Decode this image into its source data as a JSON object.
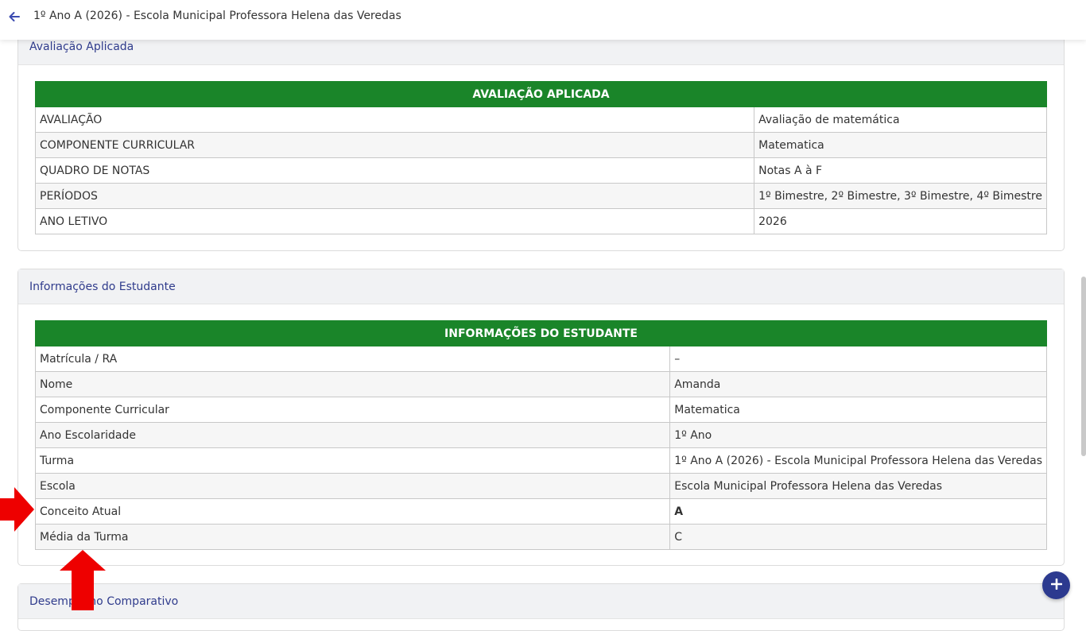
{
  "header": {
    "title": "1º Ano A (2026) - Escola Municipal Professora Helena das Veredas"
  },
  "section1": {
    "title": "Avaliação Aplicada",
    "table_title": "AVALIAÇÃO APLICADA",
    "rows": [
      {
        "label": "AVALIAÇÃO",
        "value": "Avaliação de matemática"
      },
      {
        "label": "COMPONENTE CURRICULAR",
        "value": "Matematica"
      },
      {
        "label": "QUADRO DE NOTAS",
        "value": "Notas A à F"
      },
      {
        "label": "PERÍODOS",
        "value": "1º Bimestre, 2º Bimestre, 3º Bimestre, 4º Bimestre"
      },
      {
        "label": "ANO LETIVO",
        "value": "2026"
      }
    ]
  },
  "section2": {
    "title": "Informações do Estudante",
    "table_title": "INFORMAÇÕES DO ESTUDANTE",
    "rows": [
      {
        "label": "Matrícula / RA",
        "value": "–"
      },
      {
        "label": "Nome",
        "value": "Amanda"
      },
      {
        "label": "Componente Curricular",
        "value": "Matematica"
      },
      {
        "label": "Ano Escolaridade",
        "value": "1º Ano"
      },
      {
        "label": "Turma",
        "value": "1º Ano A (2026) - Escola Municipal Professora Helena das Veredas"
      },
      {
        "label": "Escola",
        "value": "Escola Municipal Professora Helena das Veredas"
      },
      {
        "label": "Conceito Atual",
        "value": "A"
      },
      {
        "label": "Média da Turma",
        "value": "C"
      }
    ]
  },
  "section3": {
    "title": "Desempenho Comparativo"
  },
  "fab": {
    "label": "+"
  },
  "colors": {
    "header_green": "#1a8529",
    "accent_blue": "#2c3a8f",
    "annotation_red": "#ee0000"
  }
}
